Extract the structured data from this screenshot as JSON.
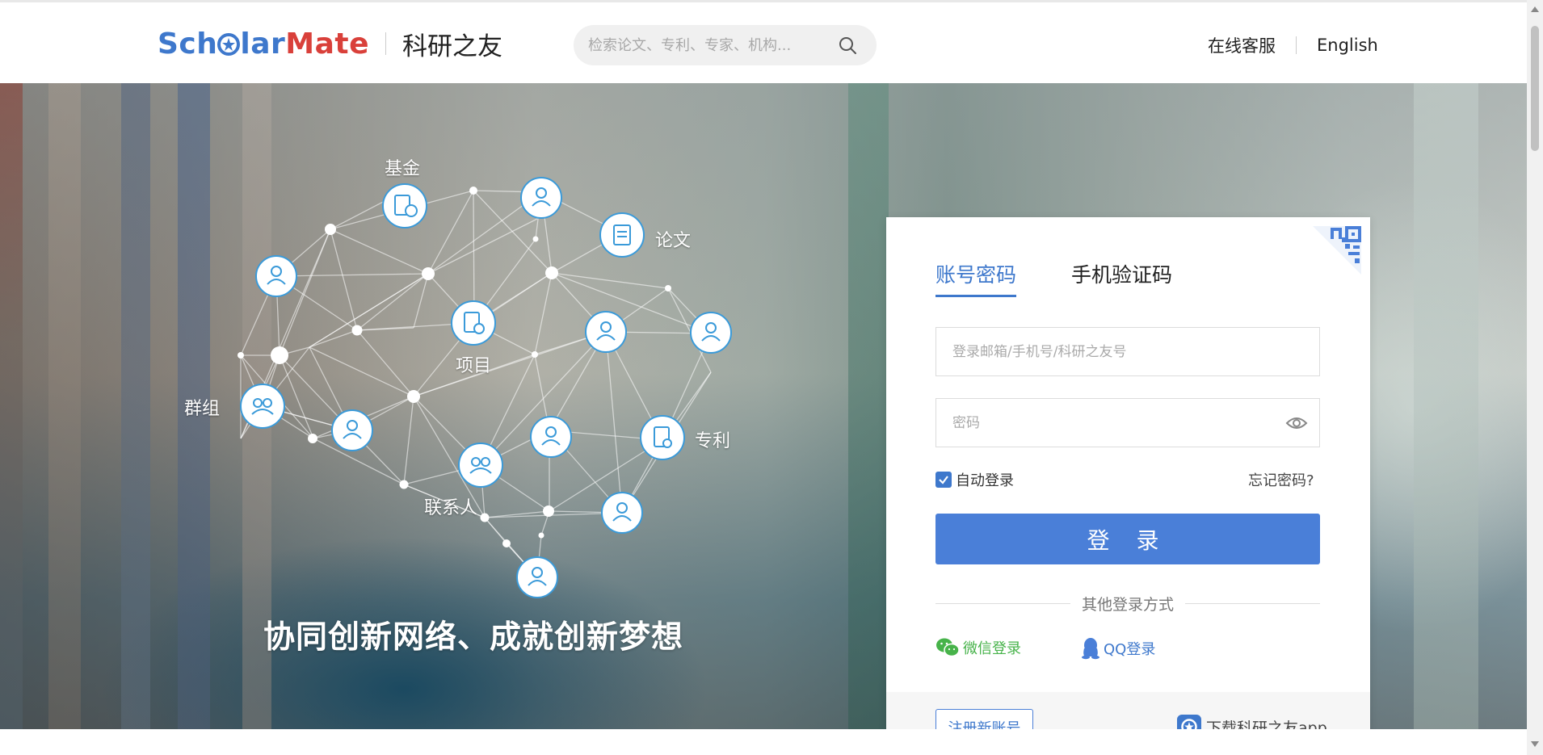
{
  "header": {
    "logo_part1": "Sch",
    "logo_part2": "lar",
    "logo_part3": "Mate",
    "logo_cn": "科研之友",
    "search_placeholder": "检索论文、专利、专家、机构...",
    "online_service": "在线客服",
    "language": "English"
  },
  "hero": {
    "slogan": "协同创新网络、成就创新梦想",
    "labels": {
      "fund": "基金",
      "paper": "论文",
      "project": "项目",
      "group": "群组",
      "patent": "专利",
      "contact": "联系人"
    }
  },
  "login": {
    "tabs": [
      "账号密码",
      "手机验证码"
    ],
    "active_tab": 0,
    "username_placeholder": "登录邮箱/手机号/科研之友号",
    "password_placeholder": "密码",
    "remember_label": "自动登录",
    "remember_checked": true,
    "forgot_label": "忘记密码?",
    "login_button": "登 录",
    "other_methods_title": "其他登录方式",
    "wechat_login": "微信登录",
    "qq_login": "QQ登录",
    "register_button": "注册新账号",
    "app_download": "下载科研之友app"
  },
  "colors": {
    "primary": "#4a7fd8",
    "logo_blue": "#3e78cc",
    "logo_red": "#d9403a",
    "wechat_green": "#47b34a"
  }
}
